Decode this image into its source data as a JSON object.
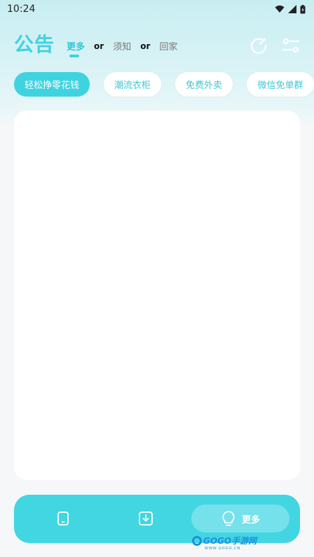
{
  "status_bar": {
    "time": "10:24"
  },
  "header": {
    "title": "公告",
    "tabs": [
      {
        "label": "更多",
        "active": true
      },
      {
        "label": "须知",
        "active": false
      },
      {
        "label": "回家",
        "active": false
      }
    ],
    "separator": "or",
    "icons": [
      "refresh-icon",
      "filter-icon"
    ]
  },
  "chips": [
    {
      "label": "轻松挣零花钱",
      "active": true
    },
    {
      "label": "潮流衣柜",
      "active": false
    },
    {
      "label": "免费外卖",
      "active": false
    },
    {
      "label": "微信免单群",
      "active": false
    }
  ],
  "bottom_nav": {
    "items": [
      "phone-icon",
      "download-icon",
      "lightbulb-icon"
    ],
    "more_label": "更多"
  },
  "watermark": {
    "brand": "GOGO手游网",
    "site": "WWW.GOGO.CN"
  },
  "colors": {
    "accent": "#3fd3e0",
    "bar": "#41d6e2",
    "background": "#f6f7f8"
  }
}
